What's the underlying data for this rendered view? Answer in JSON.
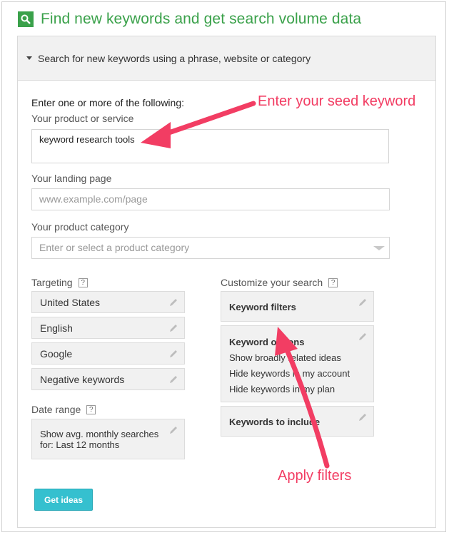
{
  "header": {
    "title": "Find new keywords and get search volume data"
  },
  "section": {
    "title": "Search for new keywords using a phrase, website or category"
  },
  "form": {
    "intro": "Enter one or more of the following:",
    "product_label": "Your product or service",
    "product_value": "keyword research tools",
    "landing_label": "Your landing page",
    "landing_placeholder": "www.example.com/page",
    "category_label": "Your product category",
    "category_placeholder": "Enter or select a product category"
  },
  "targeting": {
    "label": "Targeting",
    "help": "?",
    "items": [
      "United States",
      "English",
      "Google",
      "Negative keywords"
    ]
  },
  "date_range": {
    "label": "Date range",
    "help": "?",
    "line1": "Show avg. monthly searches",
    "line2": "for: Last 12 months"
  },
  "customize": {
    "label": "Customize your search",
    "help": "?",
    "filters_title": "Keyword filters",
    "options_title": "Keyword options",
    "options": [
      "Show broadly related ideas",
      "Hide keywords in my account",
      "Hide keywords in my plan"
    ],
    "include_title": "Keywords to include"
  },
  "actions": {
    "get_ideas": "Get ideas"
  },
  "annotations": {
    "seed": "Enter your seed keyword",
    "filters": "Apply filters"
  },
  "colors": {
    "brand_green": "#3aa14a",
    "accent_teal": "#35c0cf",
    "annotation_pink": "#f23d63"
  }
}
